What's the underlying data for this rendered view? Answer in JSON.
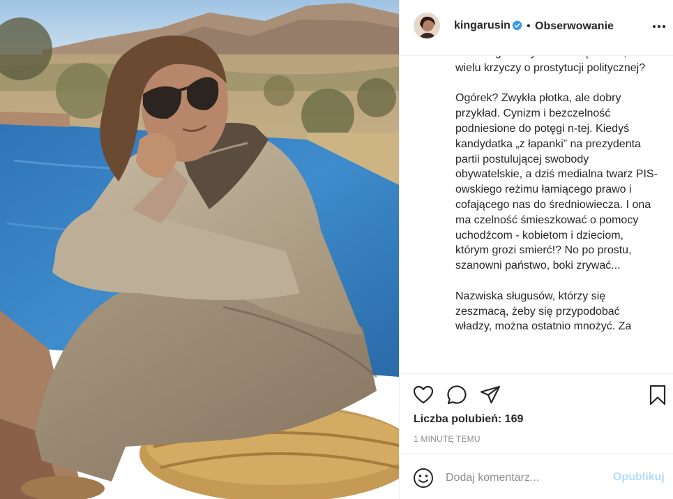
{
  "post": {
    "photo_alt_icon": "post-photo",
    "user": {
      "username": "kingarusin",
      "verified_icon": "verified-badge-icon",
      "separator": "•",
      "follow_label": "Obserwowanie"
    },
    "caption_paragraphs": [
      "zdrożnego? Czy można się dziwić, że wielu krzyczy o prostytucji politycznej?",
      "Ogórek? Zwykła płotka, ale dobry przykład. Cynizm i bezczelność podniesione do potęgi n-tej. Kiedyś kandydatka „z łapanki” na prezydenta partii postulującej swobody obywatelskie, a dziś medialna twarz PIS-owskiego reżimu łamiącego prawo i cofającego nas do średniowiecza. I ona ma czelność śmieszkować o pomocy uchodźcom - kobietom i dzieciom, którym grozi smierć!? No po prostu, szanowni państwo, boki zrywać...",
      "Nazwiska sługusów, którzy się zeszmacą, żeby się przypodobać władzy, można ostatnio mnożyć. Za"
    ],
    "likes_text": "Liczba polubień: 169",
    "timestamp": "1 MINUTĘ TEMU",
    "comment": {
      "placeholder": "Dodaj komentarz...",
      "post_label": "Opublikuj"
    }
  },
  "colors": {
    "text": "#262626",
    "muted": "#8e8e8e",
    "verified": "#3897f0",
    "post_disabled": "#b3dbff",
    "divider": "#efefef"
  }
}
